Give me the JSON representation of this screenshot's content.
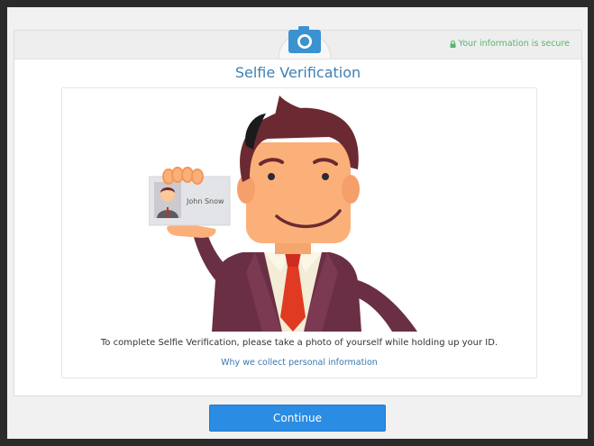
{
  "header": {
    "secure_text": "Your information is secure",
    "camera_icon": "camera-icon",
    "lock_icon": "lock-icon"
  },
  "main": {
    "title": "Selfie Verification",
    "id_card_name": "John Snow",
    "instruction": "To complete Selfie Verification, please take a photo of yourself while holding up your ID.",
    "why_link": "Why we collect personal information"
  },
  "footer": {
    "continue_label": "Continue"
  },
  "colors": {
    "accent": "#2b8ce3",
    "title": "#3e7fb6",
    "secure": "#58b56d"
  }
}
